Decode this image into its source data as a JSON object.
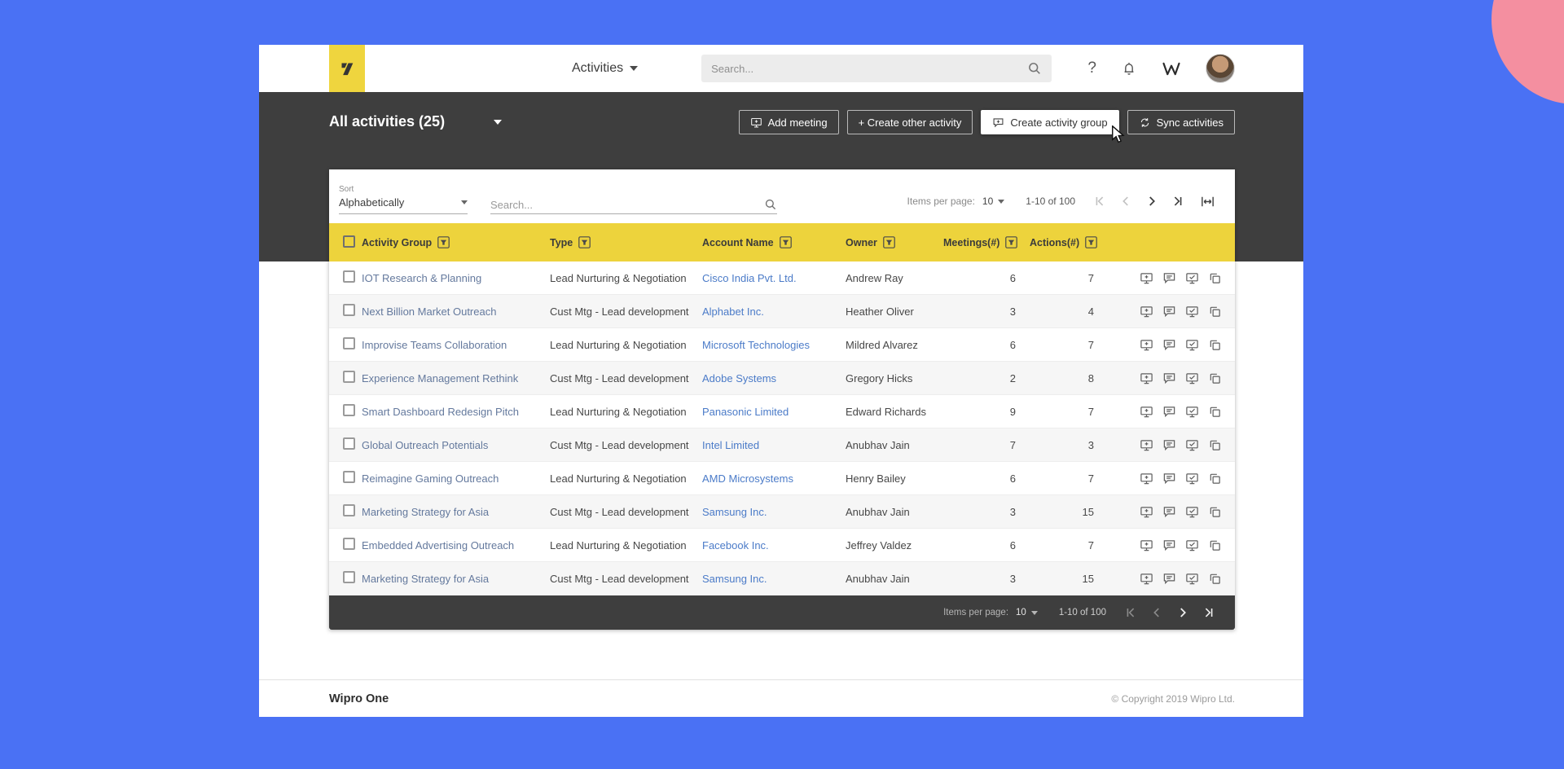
{
  "header": {
    "nav_title": "Activities",
    "search_placeholder": "Search..."
  },
  "action_bar": {
    "title": "All activities (25)",
    "buttons": [
      {
        "label": "Add meeting"
      },
      {
        "label": "+ Create other activity"
      },
      {
        "label": "Create activity group"
      },
      {
        "label": "Sync activities"
      }
    ]
  },
  "toolbar": {
    "sort_label": "Sort",
    "sort_value": "Alphabetically",
    "search_placeholder": "Search...",
    "items_per_page_label": "Items per page:",
    "items_per_page_value": "10",
    "range": "1-10 of 100"
  },
  "table": {
    "columns": [
      "Activity Group",
      "Type",
      "Account Name",
      "Owner",
      "Meetings(#)",
      "Actions(#)"
    ],
    "rows": [
      {
        "group": "IOT Research & Planning",
        "type": "Lead Nurturing & Negotiation",
        "account": "Cisco India Pvt. Ltd.",
        "owner": "Andrew Ray",
        "meetings": "6",
        "actions": "7"
      },
      {
        "group": "Next Billion Market Outreach",
        "type": "Cust Mtg - Lead development",
        "account": "Alphabet Inc.",
        "owner": "Heather Oliver",
        "meetings": "3",
        "actions": "4"
      },
      {
        "group": "Improvise Teams Collaboration",
        "type": "Lead Nurturing & Negotiation",
        "account": "Microsoft Technologies",
        "owner": "Mildred Alvarez",
        "meetings": "6",
        "actions": "7"
      },
      {
        "group": "Experience Management Rethink",
        "type": "Cust Mtg - Lead development",
        "account": "Adobe Systems",
        "owner": "Gregory Hicks",
        "meetings": "2",
        "actions": "8"
      },
      {
        "group": "Smart Dashboard Redesign Pitch",
        "type": "Lead Nurturing & Negotiation",
        "account": "Panasonic Limited",
        "owner": "Edward Richards",
        "meetings": "9",
        "actions": "7"
      },
      {
        "group": "Global Outreach Potentials",
        "type": "Cust Mtg - Lead development",
        "account": "Intel Limited",
        "owner": "Anubhav Jain",
        "meetings": "7",
        "actions": "3"
      },
      {
        "group": "Reimagine Gaming Outreach",
        "type": "Lead Nurturing & Negotiation",
        "account": "AMD Microsystems",
        "owner": "Henry Bailey",
        "meetings": "6",
        "actions": "7"
      },
      {
        "group": "Marketing Strategy for Asia",
        "type": "Cust Mtg - Lead development",
        "account": "Samsung Inc.",
        "owner": "Anubhav Jain",
        "meetings": "3",
        "actions": "15"
      },
      {
        "group": "Embedded Advertising Outreach",
        "type": "Lead Nurturing & Negotiation",
        "account": "Facebook Inc.",
        "owner": "Jeffrey Valdez",
        "meetings": "6",
        "actions": "7"
      },
      {
        "group": "Marketing Strategy for Asia",
        "type": "Cust Mtg - Lead development",
        "account": "Samsung Inc.",
        "owner": "Anubhav Jain",
        "meetings": "3",
        "actions": "15"
      }
    ]
  },
  "table_footer": {
    "items_per_page_label": "Items per page:",
    "items_per_page_value": "10",
    "range": "1-10 of 100"
  },
  "footer": {
    "brand": "Wipro One",
    "copyright": "© Copyright 2019 Wipro Ltd."
  },
  "colors": {
    "background_blue": "#4a71f4",
    "decorative_pink": "#f48fa0",
    "brand_yellow": "#edd33c",
    "band_dark": "#3e3e3e",
    "account_link_blue": "#4b7bc8",
    "group_link_blue": "#64799d"
  }
}
